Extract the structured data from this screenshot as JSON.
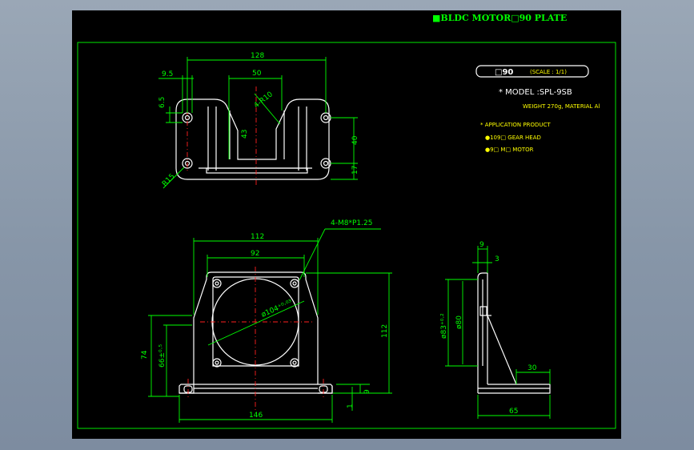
{
  "title": "■BLDC MOTOR□90 PLATE",
  "info_box": {
    "size": "□90",
    "scale": "(SCALE : 1/1)"
  },
  "model_text": "* MODEL :SPL-9SB",
  "weight_text": "WEIGHT 270g, MATERIAL Al",
  "application_text": "* APPLICATION PRODUCT",
  "app_items": [
    "●109□ GEAR HEAD",
    "●9□ M□ MOTOR"
  ],
  "top_view": {
    "dim_128": "128",
    "dim_50": "50",
    "dim_9_5": "9.5",
    "dim_6_5": "6.5",
    "dim_r10": "4-R10",
    "dim_43": "43",
    "dim_40": "40",
    "dim_17": "17",
    "dim_r15": "R15"
  },
  "front_view": {
    "dim_112_top": "112",
    "dim_92": "92",
    "hole_note": "4-M8*P1.25",
    "dim_diameter": "ø104⁺⁰·⁰³",
    "dim_74": "74",
    "dim_66": "66±⁰·⁵",
    "dim_112_right": "112",
    "dim_9": "9",
    "dim_1": "1",
    "dim_146": "146"
  },
  "side_view": {
    "dim_9": "9",
    "dim_3": "3",
    "dim_83": "ø83⁺⁰·²",
    "dim_80": "ø80",
    "dim_30": "30",
    "dim_65": "65"
  }
}
